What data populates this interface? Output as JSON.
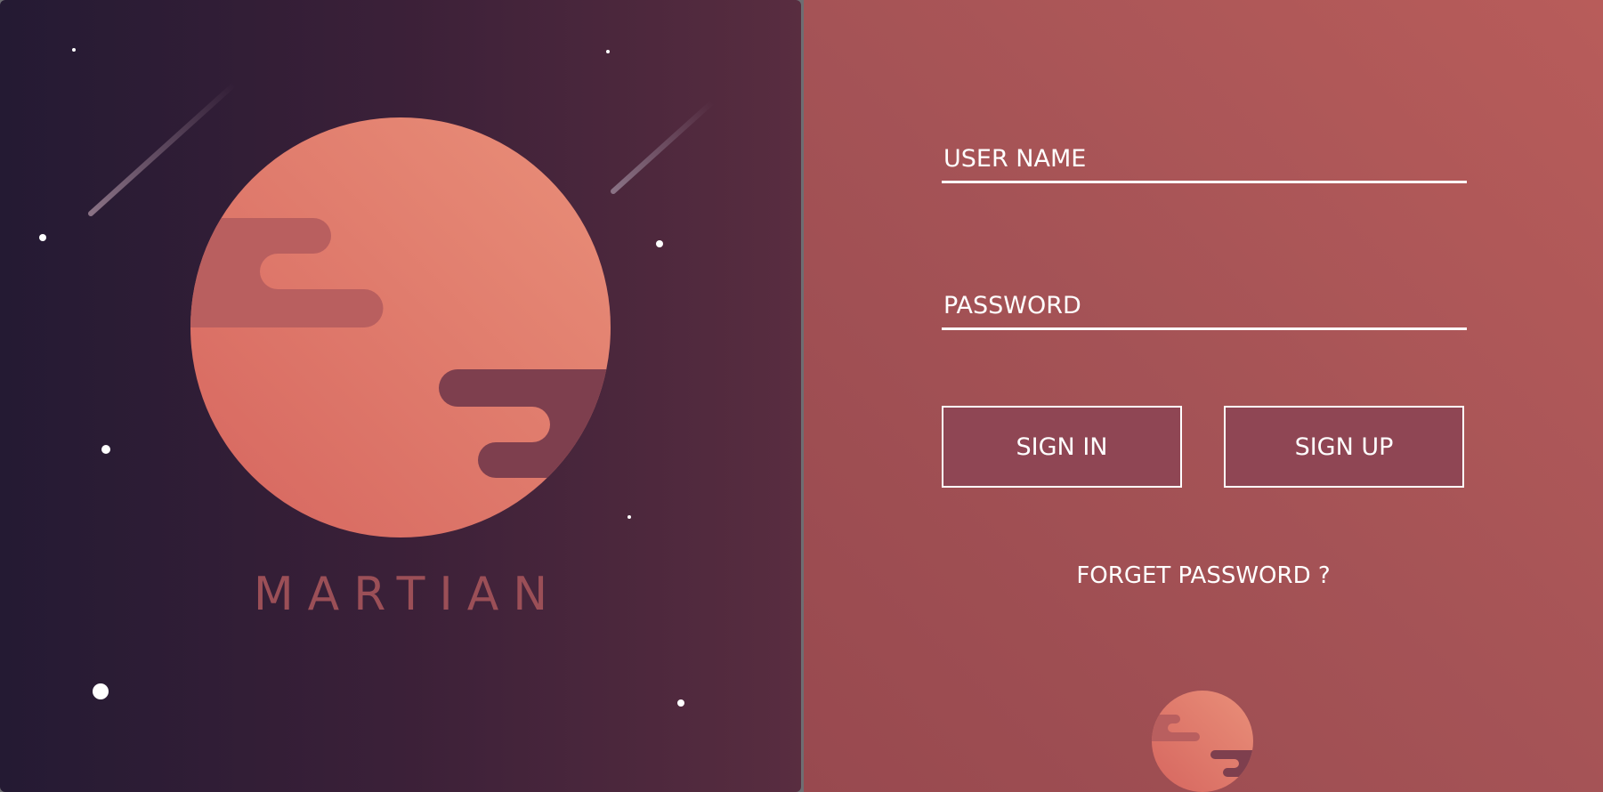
{
  "brand": {
    "name": "MARTIAN"
  },
  "login": {
    "username_placeholder": "USER NAME",
    "password_placeholder": "PASSWORD",
    "signin_label": "SIGN IN",
    "signup_label": "SIGN UP",
    "forget_label": "FORGET PASSWORD ?"
  },
  "colors": {
    "planet_light": "#e78c78",
    "planet_dark": "#d6665f",
    "left_bg_start": "#241a33",
    "left_bg_end": "#592d40",
    "right_bg": "#a55356",
    "button_fill": "#8f4654"
  }
}
